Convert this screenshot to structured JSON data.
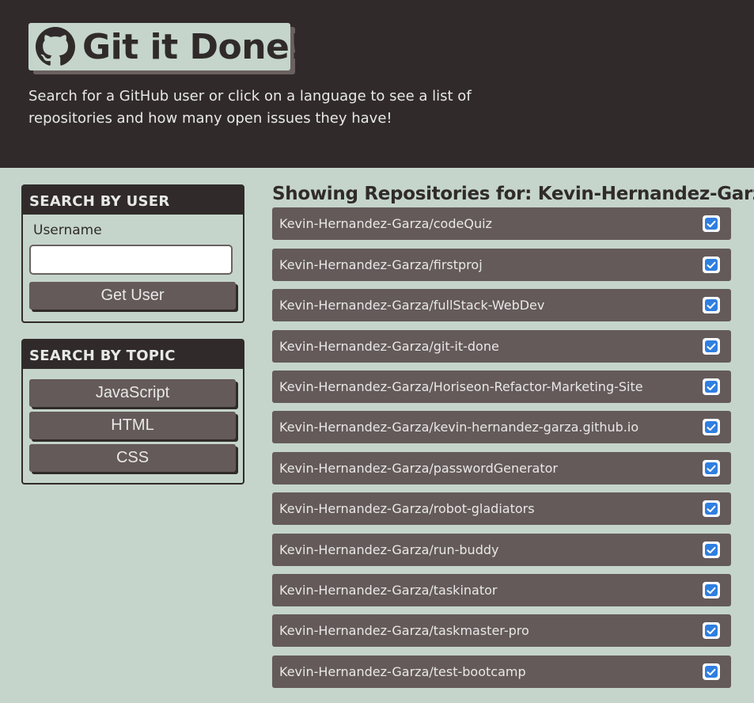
{
  "header": {
    "title": "Git it Done!",
    "logo_icon": "github-icon",
    "subtitle": "Search for a GitHub user or click on a language to see a list of repositories and how many open issues they have!"
  },
  "search_user": {
    "heading": "SEARCH BY USER",
    "field_label": "Username",
    "field_value": "",
    "button_label": "Get User"
  },
  "search_topic": {
    "heading": "SEARCH BY TOPIC",
    "languages": [
      "JavaScript",
      "HTML",
      "CSS"
    ]
  },
  "repos": {
    "heading": "Showing Repositories for: Kevin-Hernandez-Garza",
    "status_icon": "check-icon",
    "items": [
      "Kevin-Hernandez-Garza/codeQuiz",
      "Kevin-Hernandez-Garza/firstproj",
      "Kevin-Hernandez-Garza/fullStack-WebDev",
      "Kevin-Hernandez-Garza/git-it-done",
      "Kevin-Hernandez-Garza/Horiseon-Refactor-Marketing-Site",
      "Kevin-Hernandez-Garza/kevin-hernandez-garza.github.io",
      "Kevin-Hernandez-Garza/passwordGenerator",
      "Kevin-Hernandez-Garza/robot-gladiators",
      "Kevin-Hernandez-Garza/run-buddy",
      "Kevin-Hernandez-Garza/taskinator",
      "Kevin-Hernandez-Garza/taskmaster-pro",
      "Kevin-Hernandez-Garza/test-bootcamp"
    ]
  },
  "colors": {
    "page_bg": "#c5d5cc",
    "header_bg": "#302b2a",
    "item_bg": "#645a59",
    "check_accent": "#2f7fe0"
  }
}
